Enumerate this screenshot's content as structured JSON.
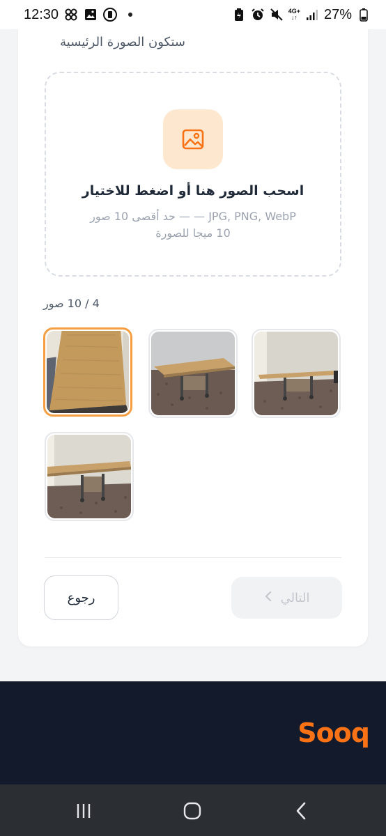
{
  "status_bar": {
    "time": "12:30",
    "network": "4G+",
    "battery": "27%",
    "icons": [
      "pinwheel-icon",
      "image-icon",
      "app-icon",
      "dot-icon",
      "battery-saver-icon",
      "alarm-icon",
      "mute-icon",
      "signal-icon",
      "battery-icon"
    ]
  },
  "card": {
    "hint_clipped": "ستكون الصورة",
    "hint_text": "ستكون الصورة الرئيسية"
  },
  "dropzone": {
    "icon": "image-icon",
    "title": "اسحب الصور هنا أو اضغط للاختيار",
    "subtitle_line1": "JPG, PNG, WebP — — حد أقصى 10 صور",
    "subtitle_line2": "10 ميجا للصورة"
  },
  "photos": {
    "counter": "4 / 10 صور",
    "items": [
      {
        "name": "photo-1",
        "selected": true
      },
      {
        "name": "photo-2",
        "selected": false
      },
      {
        "name": "photo-3",
        "selected": false
      },
      {
        "name": "photo-4",
        "selected": false
      }
    ]
  },
  "actions": {
    "back_label": "رجوع",
    "next_label": "التالي"
  },
  "footer": {
    "logo_text": "Sooq"
  },
  "colors": {
    "accent": "#f97316",
    "footer_bg": "#131a2b",
    "selected_border": "#f59e42"
  }
}
